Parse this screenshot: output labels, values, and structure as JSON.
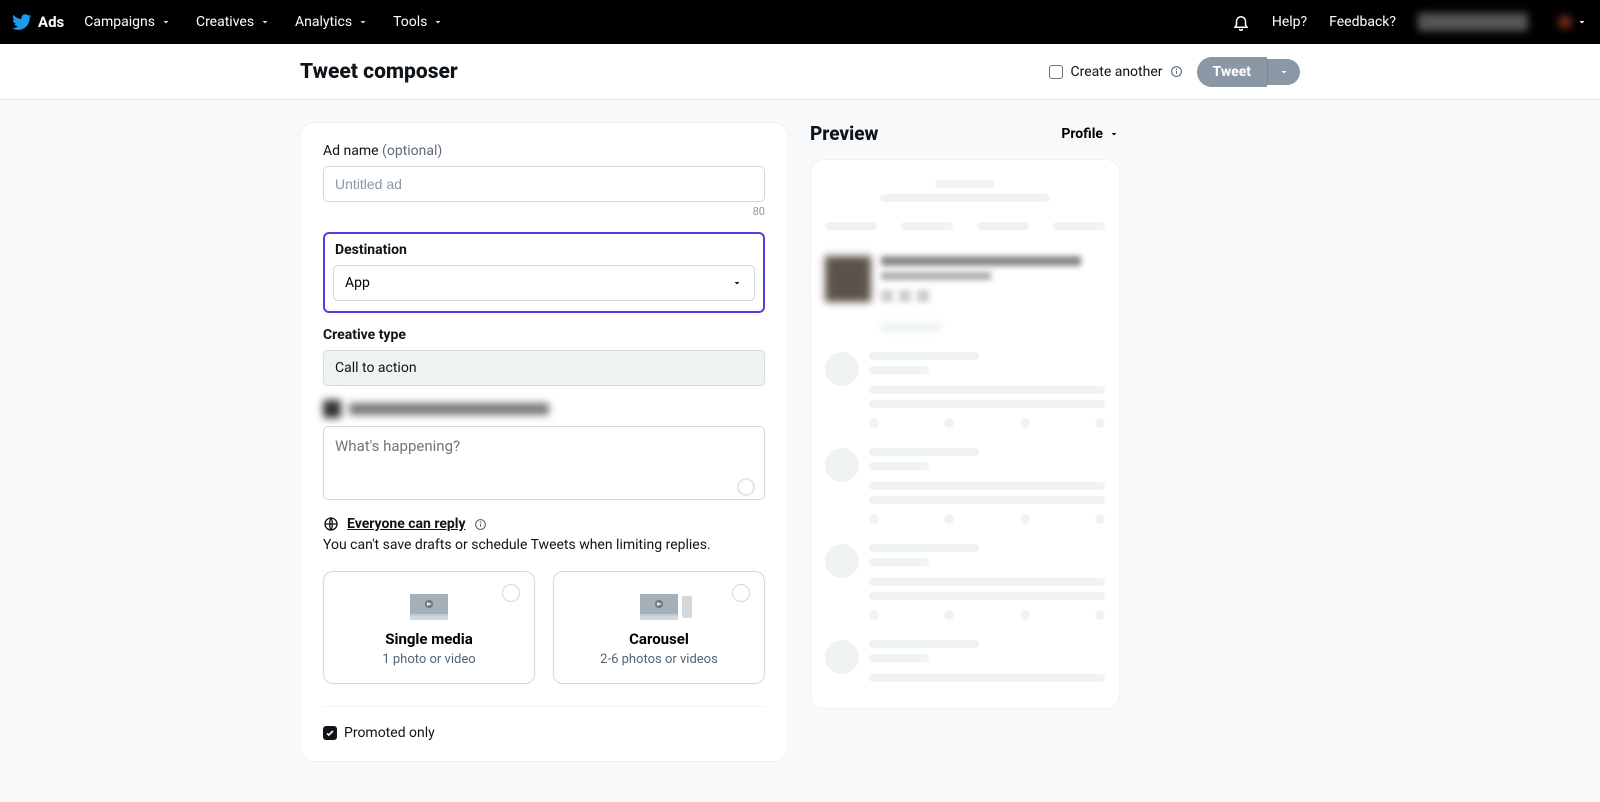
{
  "topnav": {
    "brand": "Ads",
    "items": [
      "Campaigns",
      "Creatives",
      "Analytics",
      "Tools"
    ],
    "help": "Help?",
    "feedback": "Feedback?"
  },
  "header": {
    "title": "Tweet composer",
    "create_another": "Create another",
    "tweet_btn": "Tweet"
  },
  "form": {
    "ad_name_label": "Ad name",
    "ad_name_opt": "(optional)",
    "ad_name_placeholder": "Untitled ad",
    "ad_name_counter": "80",
    "destination_label": "Destination",
    "destination_value": "App",
    "creative_type_label": "Creative type",
    "creative_type_value": "Call to action",
    "tweet_placeholder": "What's happening?",
    "reply_who": "Everyone can reply",
    "reply_hint": "You can't save drafts or schedule Tweets when limiting replies.",
    "media": {
      "single": {
        "title": "Single media",
        "sub": "1 photo or video"
      },
      "carousel": {
        "title": "Carousel",
        "sub": "2-6 photos or videos"
      }
    },
    "promoted_only": "Promoted only"
  },
  "preview": {
    "title": "Preview",
    "mode": "Profile"
  }
}
